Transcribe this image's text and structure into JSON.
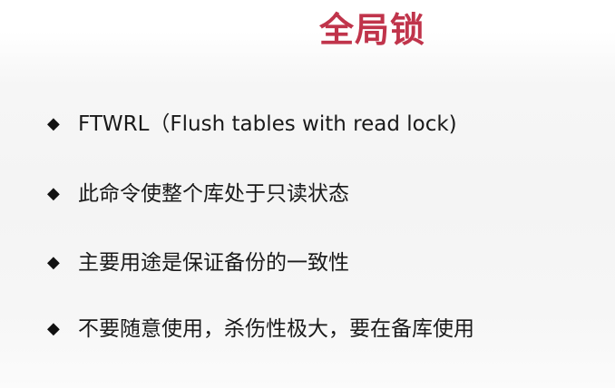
{
  "slide": {
    "title": "全局锁",
    "title_color": "#c0344b",
    "bullet_marker": "◆",
    "bullets": [
      {
        "text": "FTWRL（Flush tables with read lock)"
      },
      {
        "text": "此命令使整个库处于只读状态"
      },
      {
        "text": "主要用途是保证备份的一致性"
      },
      {
        "text": "不要随意使用，杀伤性极大，要在备库使用"
      }
    ]
  }
}
